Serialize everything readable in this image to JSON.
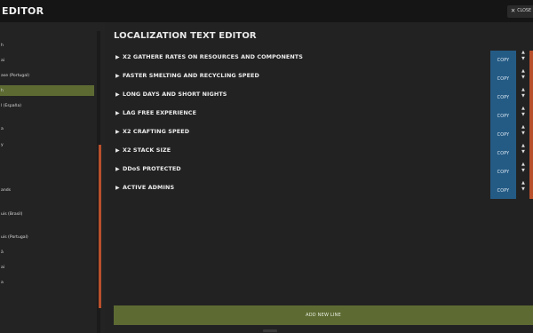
{
  "window": {
    "title": "EDITOR",
    "close_label": "CLOSE",
    "close_icon": "x"
  },
  "languages": [
    {
      "label": "h"
    },
    {
      "label": "ai"
    },
    {
      "label": "ase (Portugal)"
    },
    {
      "label": "h",
      "active": true
    },
    {
      "label": "l (España)"
    },
    {
      "label": "a"
    },
    {
      "label": "y"
    },
    {
      "label": ""
    },
    {
      "label": ""
    },
    {
      "label": "ands"
    },
    {
      "label": "uis (Brasil)"
    },
    {
      "label": "uis (Portugal)"
    },
    {
      "label": "ä"
    },
    {
      "label": "ai"
    },
    {
      "label": "a"
    }
  ],
  "editor": {
    "heading": "LOCALIZATION TEXT EDITOR",
    "copy_label": "COPY",
    "rows": [
      "X2 GATHERE RATES ON RESOURCES AND COMPONENTS",
      "FASTER SMELTING AND RECYCLING SPEED",
      "LONG DAYS AND SHORT NIGHTS",
      "LAG FREE EXPERIENCE",
      "X2 CRAFTING SPEED",
      "X2 STACK SIZE",
      "DDoS PROTECTED",
      "ACTIVE ADMINS"
    ],
    "add_new_line": "ADD NEW LINE"
  },
  "colors": {
    "accent_green": "#5d6b33",
    "copy_blue": "#245b85",
    "accent_orange": "#b8502c"
  }
}
